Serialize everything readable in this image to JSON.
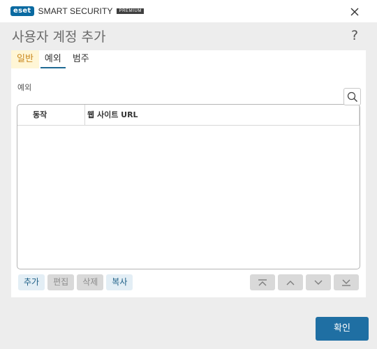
{
  "titlebar": {
    "brand": "eset",
    "product": "SMART SECURITY",
    "edition": "PREMIUM"
  },
  "dialog": {
    "title": "사용자 계정 추가",
    "help": "?"
  },
  "tabs": [
    {
      "label": "일반",
      "state": "highlighted"
    },
    {
      "label": "예외",
      "state": "active"
    },
    {
      "label": "범주",
      "state": "normal"
    }
  ],
  "exceptions": {
    "section_label": "예외",
    "columns": [
      "동작",
      "웹 사이트 URL"
    ],
    "rows": []
  },
  "actions": {
    "add": "추가",
    "edit": "편집",
    "delete": "삭제",
    "copy": "복사"
  },
  "move_buttons": [
    "move-top-icon",
    "move-up-icon",
    "move-down-icon",
    "move-bottom-icon"
  ],
  "footer": {
    "ok": "확인"
  },
  "colors": {
    "accent": "#1f6fa3",
    "brand": "#0a6aa1",
    "tab_highlight_bg": "#fff6d6",
    "tab_highlight_text": "#c9871d"
  }
}
